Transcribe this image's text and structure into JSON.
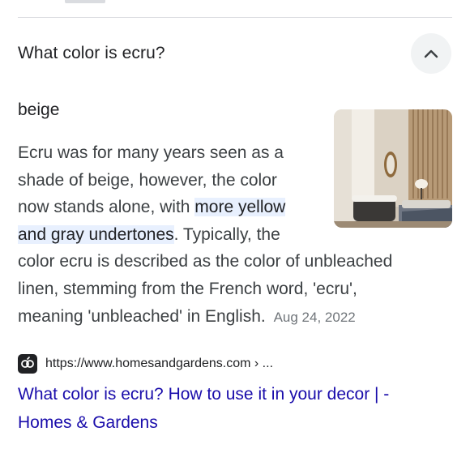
{
  "faq": {
    "question": "What color is ecru?",
    "expanded": true,
    "collapse_icon": "chevron-up-icon"
  },
  "answer": {
    "short": "beige",
    "lines": [
      "Ecru was for many years seen as a",
      "shade of beige, however, the color",
      "now stands alone, with ",
      "more yellow",
      "and gray undertones",
      ". Typically, the",
      "color ecru is described as the color of unbleached",
      "linen, stemming from the French word, 'ecru',",
      "meaning 'unbleached' in English."
    ],
    "date": "Aug 24, 2022",
    "image_icon": "room-photo"
  },
  "source": {
    "favicon_icon": "homes-and-gardens-favicon",
    "url": "https://www.homesandgardens.com › ...",
    "title_line1": "What color is ecru? How to use it in your decor | -",
    "title_line2": "Homes & Gardens"
  },
  "colors": {
    "link": "#1a0dab",
    "highlight": "#e8f0fe",
    "text": "#202124",
    "muted": "#70757a",
    "divider": "#dadce0"
  }
}
